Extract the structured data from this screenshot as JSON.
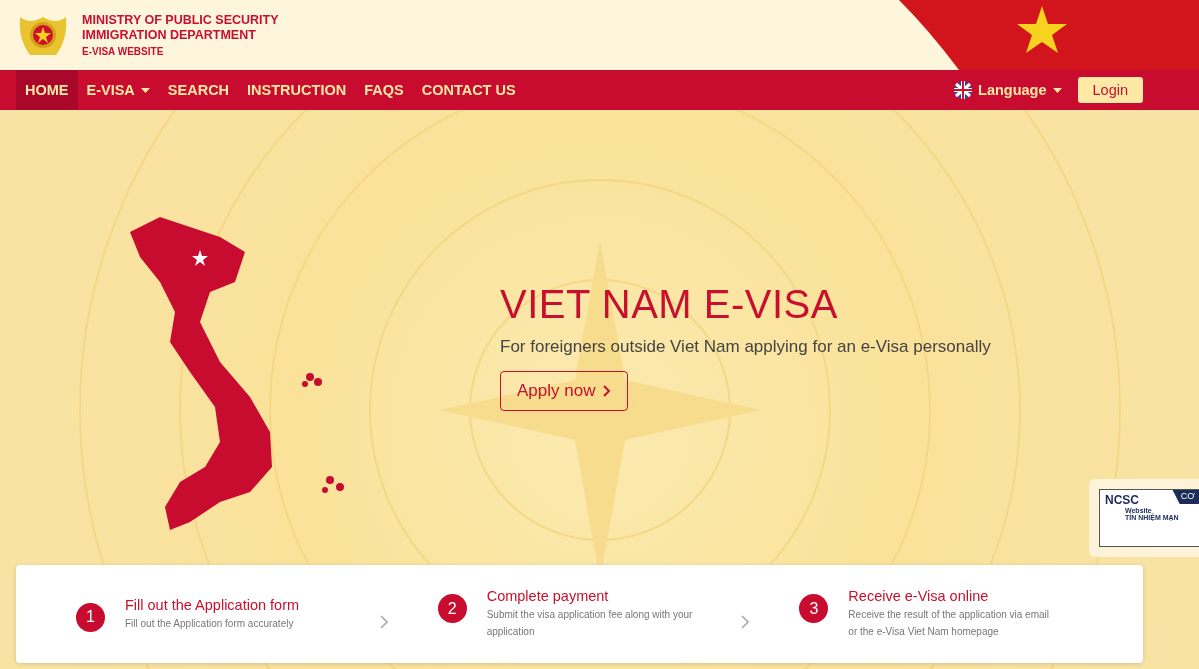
{
  "header": {
    "title_lines": [
      "MINISTRY OF PUBLIC SECURITY",
      "IMMIGRATION DEPARTMENT"
    ],
    "subtitle": "E-VISA WEBSITE"
  },
  "nav": {
    "items": [
      {
        "label": "HOME",
        "selected": true,
        "dropdown": false
      },
      {
        "label": "E-VISA",
        "selected": false,
        "dropdown": true
      },
      {
        "label": "SEARCH",
        "selected": false,
        "dropdown": false
      },
      {
        "label": "INSTRUCTION",
        "selected": false,
        "dropdown": false
      },
      {
        "label": "FAQS",
        "selected": false,
        "dropdown": false
      },
      {
        "label": "CONTACT US",
        "selected": false,
        "dropdown": false
      }
    ],
    "language": "Language",
    "login": "Login"
  },
  "hero": {
    "title": "VIET NAM E-VISA",
    "subtitle": "For foreigners outside Viet Nam applying for an e-Visa personally",
    "button": "Apply now"
  },
  "trust_badge": {
    "brand": "NCSC",
    "corner": "CƠ",
    "line_1": "Website",
    "line_2": "TÍN NHIỆM MẠN"
  },
  "steps": [
    {
      "number": "1",
      "title": "Fill out the Application form",
      "description": "Fill out the Application form accurately"
    },
    {
      "number": "2",
      "title": "Complete payment",
      "description": "Submit the visa application fee along with your application"
    },
    {
      "number": "3",
      "title": "Receive e-Visa online",
      "description": "Receive the result of the application via email or the e-Visa Viet Nam homepage"
    }
  ]
}
